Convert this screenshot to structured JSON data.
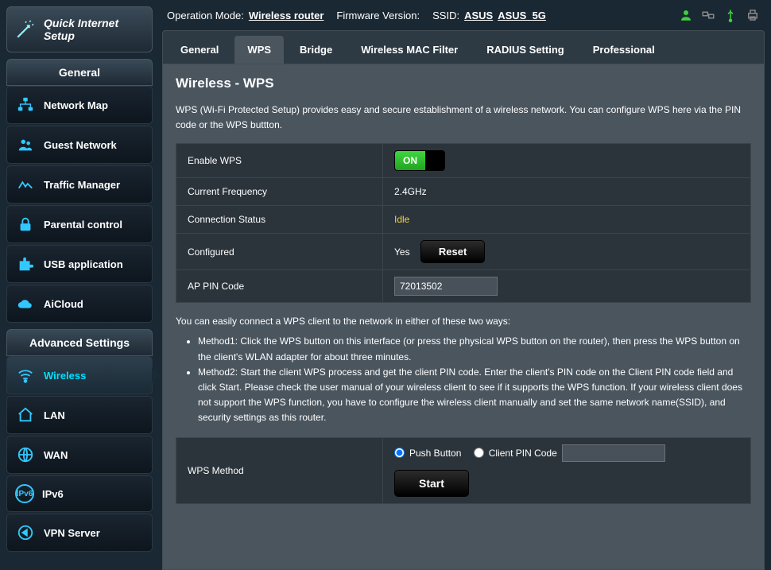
{
  "qis_label": "Quick Internet Setup",
  "topbar": {
    "operation_mode_label": "Operation Mode:",
    "operation_mode_value": "Wireless router",
    "firmware_label": "Firmware Version:",
    "ssid_label": "SSID:",
    "ssid_values": [
      "ASUS",
      "ASUS_5G"
    ]
  },
  "sections": {
    "general_header": "General",
    "general_items": [
      "Network Map",
      "Guest Network",
      "Traffic Manager",
      "Parental control",
      "USB application",
      "AiCloud"
    ],
    "advanced_header": "Advanced Settings",
    "advanced_items": [
      "Wireless",
      "LAN",
      "WAN",
      "IPv6",
      "VPN Server"
    ],
    "active_advanced_index": 0
  },
  "tabs": [
    "General",
    "WPS",
    "Bridge",
    "Wireless MAC Filter",
    "RADIUS Setting",
    "Professional"
  ],
  "active_tab_index": 1,
  "page": {
    "title": "Wireless - WPS",
    "desc": "WPS (Wi-Fi Protected Setup) provides easy and secure establishment of a wireless network. You can configure WPS here via the PIN code or the WPS buttton.",
    "rows": {
      "enable_wps_label": "Enable WPS",
      "enable_wps_value": "ON",
      "current_freq_label": "Current Frequency",
      "current_freq_value": "2.4GHz",
      "conn_status_label": "Connection Status",
      "conn_status_value": "Idle",
      "configured_label": "Configured",
      "configured_value": "Yes",
      "reset_btn": "Reset",
      "ap_pin_label": "AP PIN Code",
      "ap_pin_value": "72013502"
    },
    "methods_intro": "You can easily connect a WPS client to the network in either of these two ways:",
    "method1": "Method1: Click the WPS button on this interface (or press the physical WPS button on the router), then press the WPS button on the client's WLAN adapter for about three minutes.",
    "method2": "Method2: Start the client WPS process and get the client PIN code. Enter the client's PIN code on the Client PIN code field and click Start. Please check the user manual of your wireless client to see if it supports the WPS function. If your wireless client does not support the WPS function, you have to configure the wireless client manually and set the same network name(SSID), and security settings as this router.",
    "wps_method_label": "WPS Method",
    "push_button_label": "Push Button",
    "client_pin_label": "Client PIN Code",
    "start_btn": "Start"
  }
}
